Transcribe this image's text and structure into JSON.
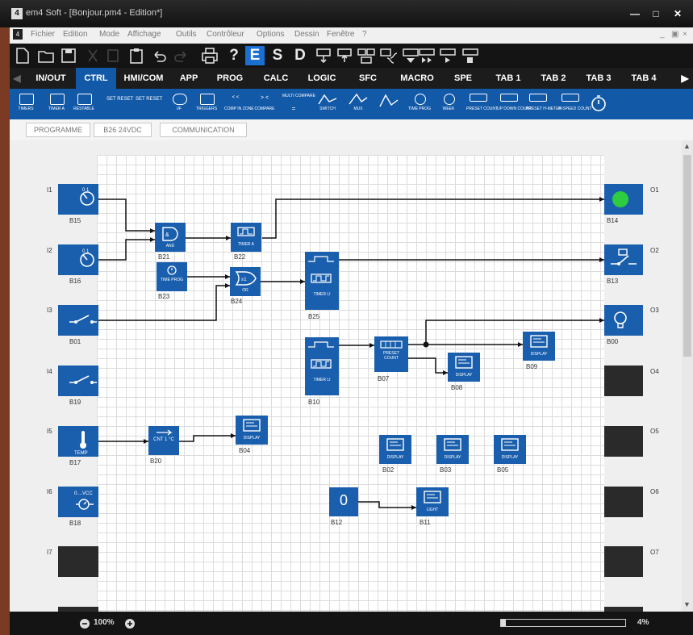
{
  "window": {
    "title": "em4 Soft - [Bonjour.pm4 - Edition*]",
    "app_icon": "4"
  },
  "menu": [
    "Fichier",
    "Edition",
    "Mode",
    "Affichage",
    "Outils",
    "Contrôleur",
    "Options",
    "Dessin",
    "Fenêtre",
    "?"
  ],
  "toolbar": {
    "help": "?",
    "e": "E",
    "s": "S",
    "d": "D"
  },
  "tabs": [
    "IN/OUT",
    "CTRL",
    "HMI/COM",
    "APP",
    "PROG",
    "CALC",
    "LOGIC",
    "SFC",
    "MACRO",
    "SPE",
    "TAB 1",
    "TAB 2",
    "TAB 3",
    "TAB 4"
  ],
  "active_tab": "CTRL",
  "ribbon": [
    {
      "label": "TIMERS"
    },
    {
      "label": "TIMER A"
    },
    {
      "label": "RESTABLE"
    },
    {
      "label": "SET RESET"
    },
    {
      "label": "SET RESET"
    },
    {
      "label": "I/F"
    },
    {
      "label": "TRIGGERS"
    },
    {
      "label": "COMP IN ZONE"
    },
    {
      "label": "COMPARE"
    },
    {
      "label": "MULTI COMPARE"
    },
    {
      "label": "SWITCH"
    },
    {
      "label": "MUX"
    },
    {
      "label": ""
    },
    {
      "label": "TIME PROG"
    },
    {
      "label": "WEEK"
    },
    {
      "label": "PRESET COUNT"
    },
    {
      "label": "UP DOWN COUNT"
    },
    {
      "label": "PRESET H-METER"
    },
    {
      "label": "H-SPEED COUNT"
    },
    {
      "label": ""
    }
  ],
  "subtabs": [
    "PROGRAMME",
    "B26 24VDC",
    "COMMUNICATION"
  ],
  "inputs": [
    {
      "pin": "I1",
      "block": "B15",
      "icon": "clock-icon"
    },
    {
      "pin": "I2",
      "block": "B16",
      "icon": "clock-icon"
    },
    {
      "pin": "I3",
      "block": "B01",
      "icon": "switch-icon"
    },
    {
      "pin": "I4",
      "block": "B19",
      "icon": "switch-icon"
    },
    {
      "pin": "I5",
      "block": "B17",
      "icon": "thermometer-icon"
    },
    {
      "pin": "I6",
      "block": "B18",
      "icon": "voltage-icon"
    },
    {
      "pin": "I7",
      "block": "",
      "icon": ""
    }
  ],
  "outputs": [
    {
      "pin": "O1",
      "block": "B14",
      "icon": "green-lamp-icon"
    },
    {
      "pin": "O2",
      "block": "B13",
      "icon": "relay-icon"
    },
    {
      "pin": "O3",
      "block": "B00",
      "icon": "bulb-icon"
    },
    {
      "pin": "O4",
      "block": ""
    },
    {
      "pin": "O5",
      "block": ""
    },
    {
      "pin": "O6",
      "block": ""
    },
    {
      "pin": "O7",
      "block": ""
    }
  ],
  "blocks": {
    "b21": {
      "id": "B21",
      "text": "AND"
    },
    "b22": {
      "id": "B22",
      "text": "TIMER A"
    },
    "b23": {
      "id": "B23",
      "text": "TIME PROG"
    },
    "b24": {
      "id": "B24",
      "text": "OR"
    },
    "b25": {
      "id": "B25",
      "text": "TIMER LI"
    },
    "b10": {
      "id": "B10",
      "text": "TIMER LI"
    },
    "b07": {
      "id": "B07",
      "text": "PRESET COUNT"
    },
    "b08": {
      "id": "B08",
      "text": "DISPLAY"
    },
    "b09": {
      "id": "B09",
      "text": "DISPLAY"
    },
    "b20": {
      "id": "B20",
      "text": "CNT 1 °C"
    },
    "b04": {
      "id": "B04",
      "text": "DISPLAY"
    },
    "b02": {
      "id": "B02",
      "text": "DISPLAY"
    },
    "b03": {
      "id": "B03",
      "text": "DISPLAY"
    },
    "b05": {
      "id": "B05",
      "text": "DISPLAY"
    },
    "b12": {
      "id": "B12",
      "text": "0"
    },
    "b11": {
      "id": "B11",
      "text": "LIGHT"
    }
  },
  "status": {
    "zoom": "100%",
    "scroll_value": "4%",
    "scroll_fraction": 0.04
  },
  "colors": {
    "block": "#1a5fae",
    "ribbon": "#1259a8",
    "lamp_on": "#2ecc40",
    "link_accent": "#2e9e2e"
  }
}
